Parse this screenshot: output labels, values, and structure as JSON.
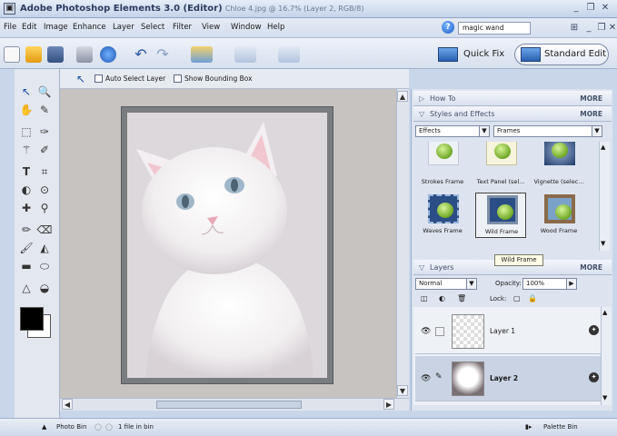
{
  "window": {
    "app_name": "Adobe Photoshop Elements 3.0 (Editor)",
    "doc_info": "Chloe 4.jpg @ 16.7% (Layer 2, RGB/8)",
    "min_label": "_",
    "restore_label": "❐",
    "close_label": "✕"
  },
  "menu": {
    "items": [
      "File",
      "Edit",
      "Image",
      "Enhance",
      "Layer",
      "Select",
      "Filter",
      "View",
      "Window",
      "Help"
    ],
    "search_value": "magic wand"
  },
  "shortcuts": {
    "quick_fix_label": "Quick Fix",
    "standard_edit_label": "Standard Edit"
  },
  "options": {
    "auto_select_label": "Auto Select Layer",
    "show_bounding_label": "Show Bounding Box"
  },
  "palette": {
    "how_to_label": "How To",
    "styles_label": "Styles and Effects",
    "layers_label": "Layers",
    "more_label": "MORE",
    "category_value": "Effects",
    "library_value": "Frames",
    "effects": [
      {
        "caption": "Strokes Frame"
      },
      {
        "caption": "Text Panel (sel..."
      },
      {
        "caption": "Vignette (selec..."
      },
      {
        "caption": "Waves Frame"
      },
      {
        "caption": "Wild Frame"
      },
      {
        "caption": "Wood Frame"
      }
    ],
    "tooltip": "Wild Frame",
    "blend_mode": "Normal",
    "opacity_label": "Opacity:",
    "opacity_value": "100%",
    "lock_label": "Lock:",
    "layers": [
      {
        "name": "Layer 1"
      },
      {
        "name": "Layer 2"
      }
    ]
  },
  "status": {
    "photo_bin_label": "Photo Bin",
    "file_count": "1 file in bin",
    "palette_bin_label": "Palette Bin"
  },
  "colors": {
    "foreground": "#000000",
    "background": "#ffffff",
    "accent": "#c5d3ea"
  }
}
